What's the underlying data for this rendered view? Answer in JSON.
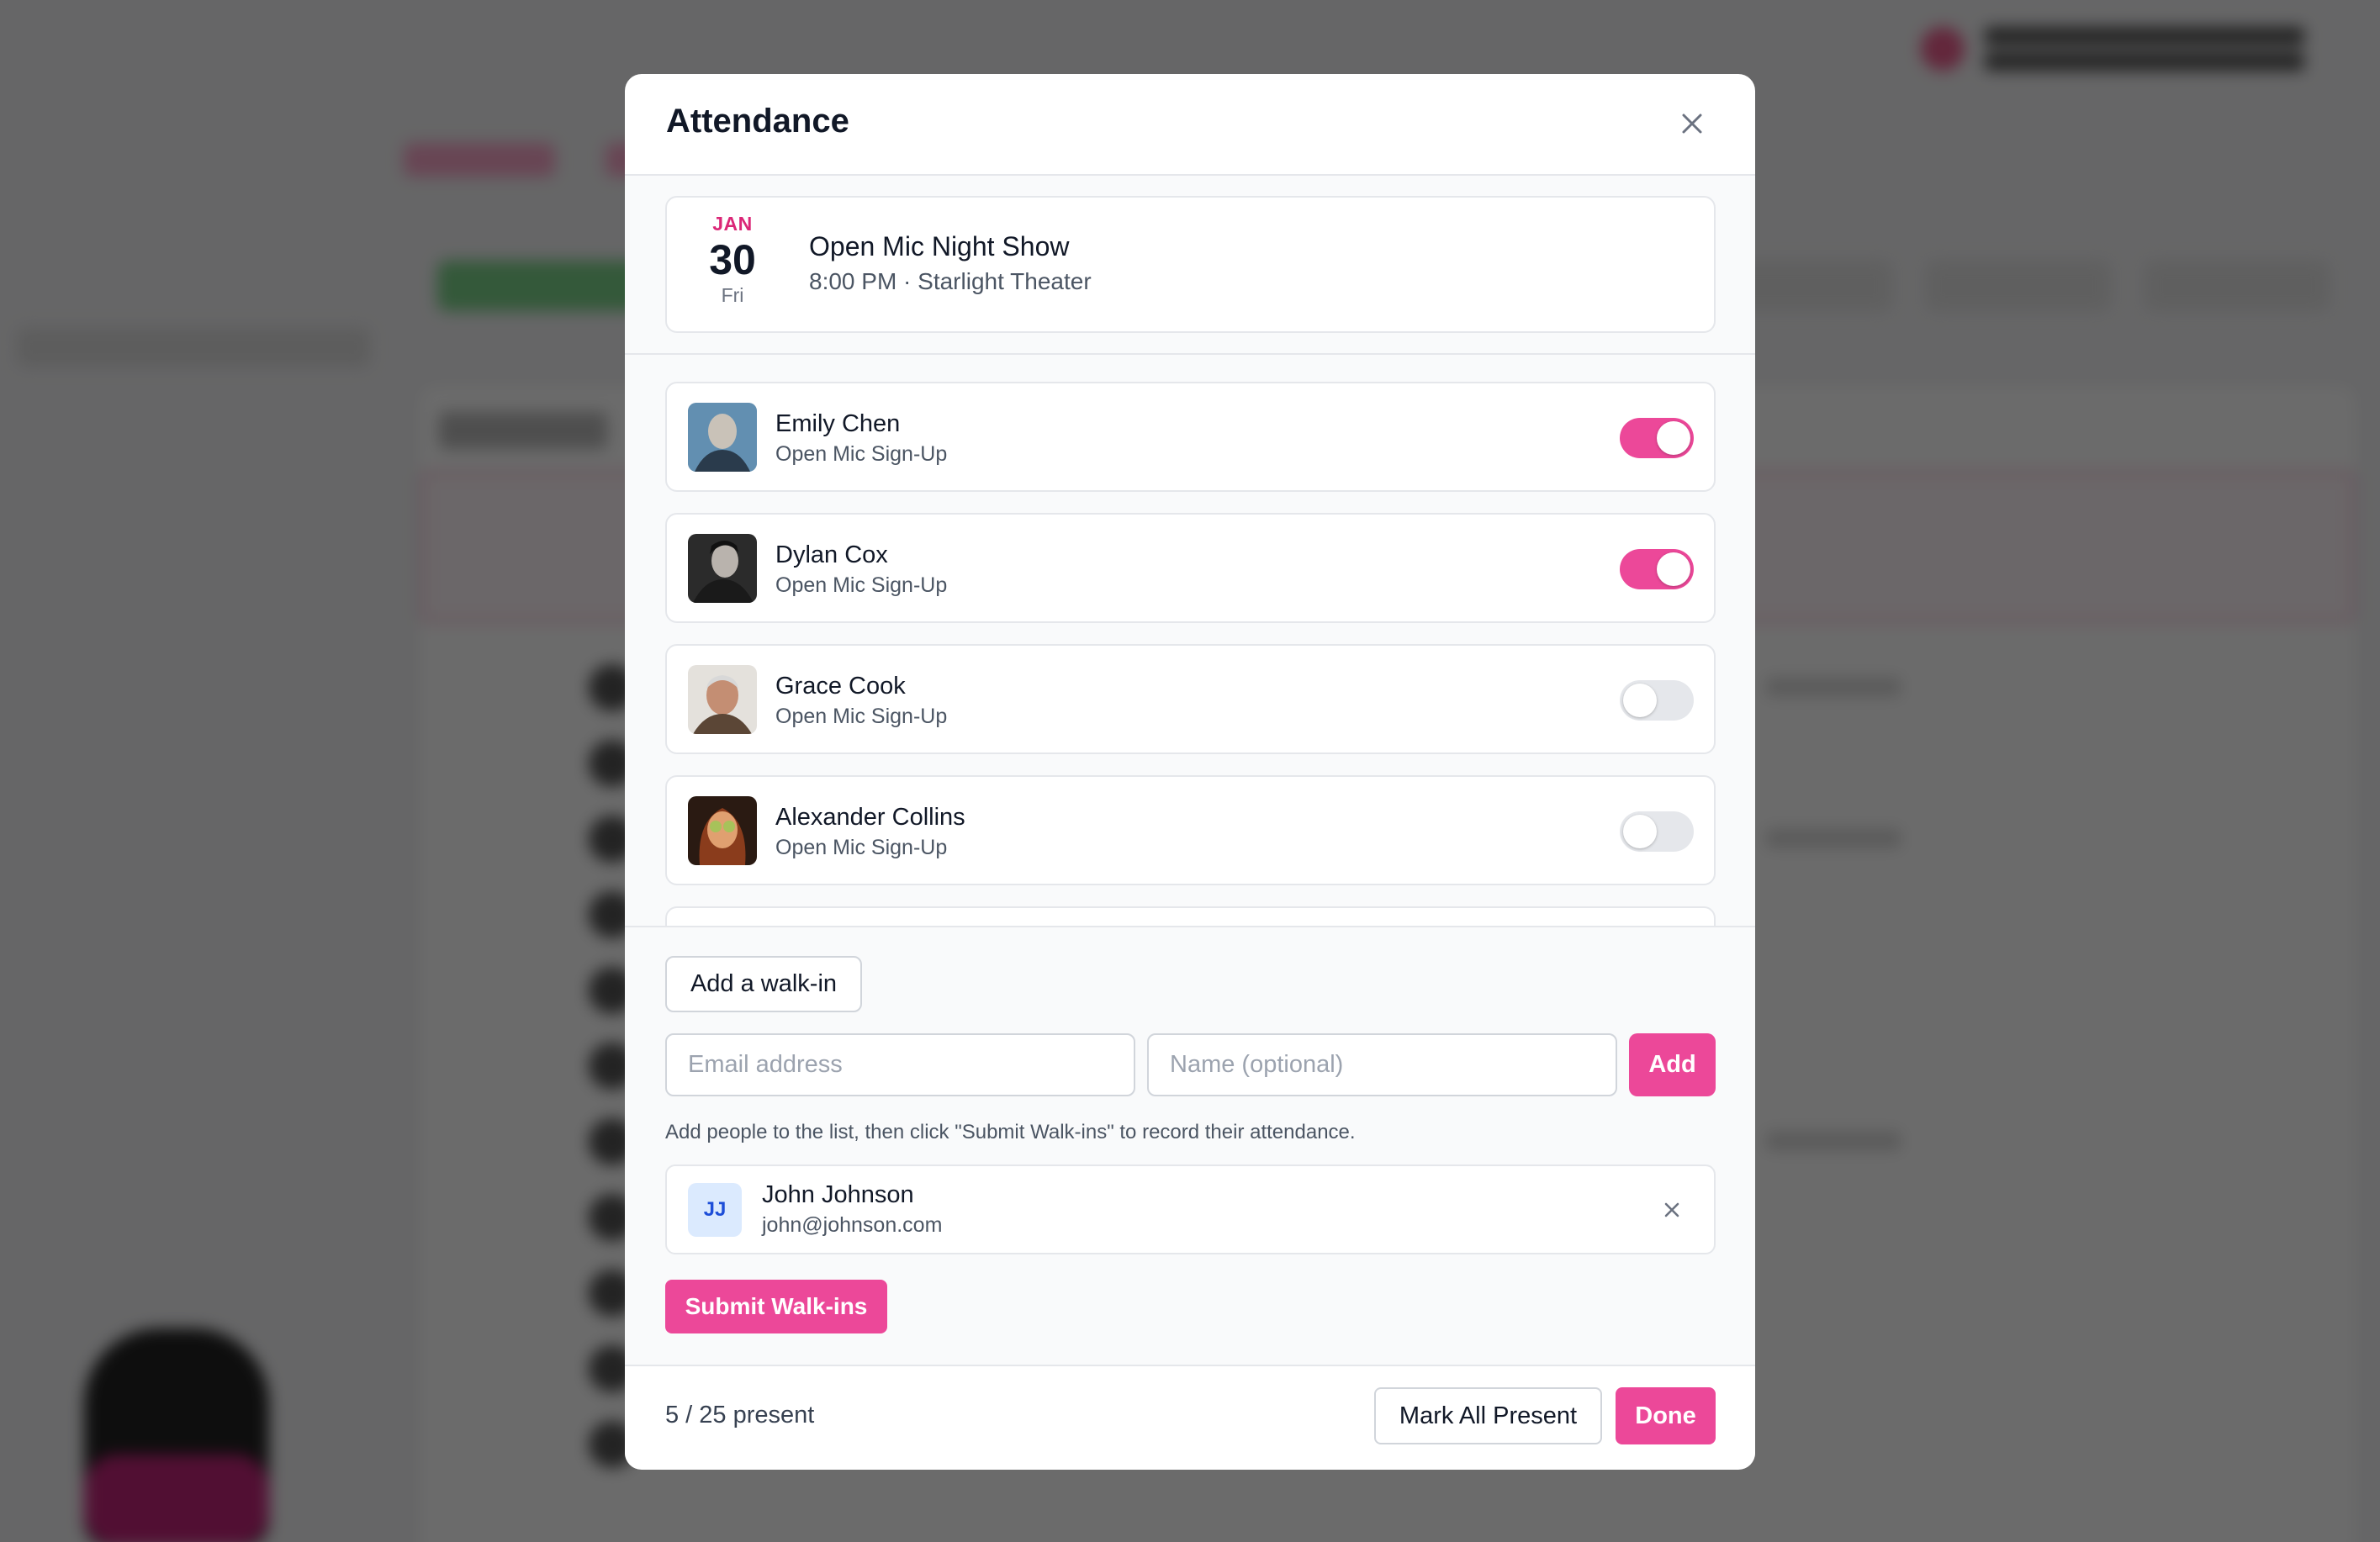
{
  "modal": {
    "title": "Attendance",
    "close_icon": "close-icon"
  },
  "event": {
    "month": "JAN",
    "day": "30",
    "weekday": "Fri",
    "name": "Open Mic Night Show",
    "meta": "8:00 PM · Starlight Theater"
  },
  "attendees": [
    {
      "name": "Emily Chen",
      "subtitle": "Open Mic Sign-Up",
      "present": true
    },
    {
      "name": "Dylan Cox",
      "subtitle": "Open Mic Sign-Up",
      "present": true
    },
    {
      "name": "Grace Cook",
      "subtitle": "Open Mic Sign-Up",
      "present": false
    },
    {
      "name": "Alexander Collins",
      "subtitle": "Open Mic Sign-Up",
      "present": false
    }
  ],
  "walkin": {
    "add_walkin_label": "Add a walk-in",
    "email_placeholder": "Email address",
    "name_placeholder": "Name (optional)",
    "add_label": "Add",
    "helper_text": "Add people to the list, then click \"Submit Walk-ins\" to record their attendance.",
    "pending": [
      {
        "initials": "JJ",
        "name": "John Johnson",
        "email": "john@johnson.com"
      }
    ],
    "submit_label": "Submit Walk-ins"
  },
  "footer": {
    "present_count": "5 / 25 present",
    "mark_all_label": "Mark All Present",
    "done_label": "Done"
  },
  "colors": {
    "accent": "#ec4899",
    "accent_text": "#db2777",
    "toggle_off": "#e5e7eb"
  }
}
